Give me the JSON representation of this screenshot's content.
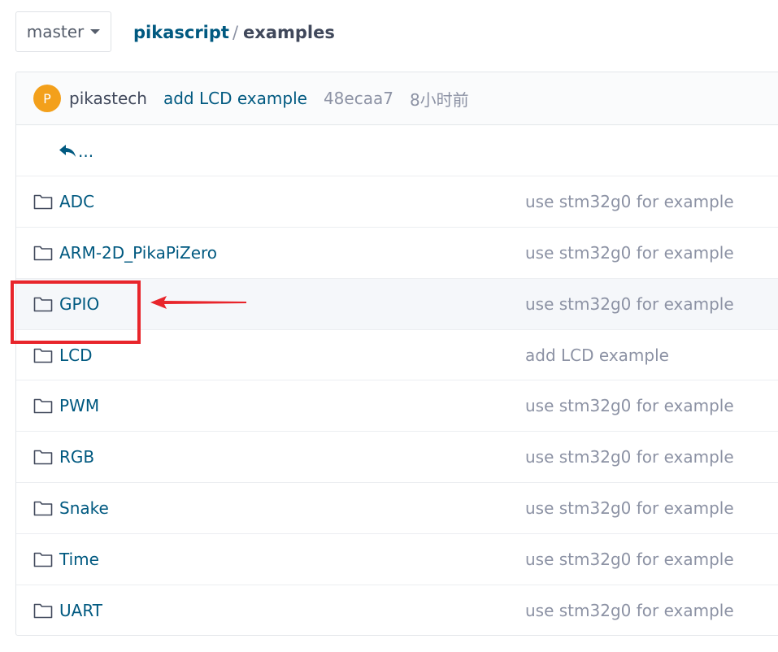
{
  "branch": {
    "label": "master",
    "icon": "caret-down-icon"
  },
  "breadcrumb": {
    "repo": "pikascript",
    "separator": "/",
    "current": "examples"
  },
  "commit": {
    "avatar_letter": "P",
    "author": "pikastech",
    "message": "add LCD example",
    "hash": "48ecaa7",
    "time": "8小时前"
  },
  "back": {
    "label": "...",
    "icon": "reply-arrow-icon"
  },
  "files": [
    {
      "name": "ADC",
      "message": "use stm32g0 for example",
      "icon": "folder-icon"
    },
    {
      "name": "ARM-2D_PikaPiZero",
      "message": "use stm32g0 for example",
      "icon": "folder-icon"
    },
    {
      "name": "GPIO",
      "message": "use stm32g0 for example",
      "icon": "folder-icon"
    },
    {
      "name": "LCD",
      "message": "add LCD example",
      "icon": "folder-icon"
    },
    {
      "name": "PWM",
      "message": "use stm32g0 for example",
      "icon": "folder-icon"
    },
    {
      "name": "RGB",
      "message": "use stm32g0 for example",
      "icon": "folder-icon"
    },
    {
      "name": "Snake",
      "message": "use stm32g0 for example",
      "icon": "folder-icon"
    },
    {
      "name": "Time",
      "message": "use stm32g0 for example",
      "icon": "folder-icon"
    },
    {
      "name": "UART",
      "message": "use stm32g0 for example",
      "icon": "folder-icon"
    }
  ],
  "colors": {
    "link": "#005980",
    "muted": "#8c92a4",
    "avatar": "#f3a01b",
    "annotation": "#e8252b"
  }
}
